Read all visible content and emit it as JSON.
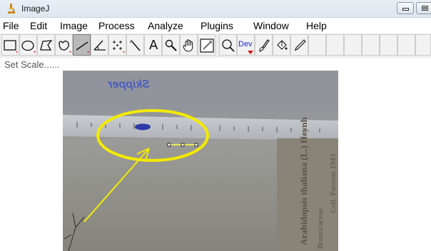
{
  "window": {
    "title": "ImageJ",
    "title_icon": "microscope-icon",
    "controls": [
      "minimize-icon",
      "maximize-icon"
    ]
  },
  "menu": [
    {
      "label": "File"
    },
    {
      "label": "Edit"
    },
    {
      "label": "Image"
    },
    {
      "label": "Process"
    },
    {
      "label": "Analyze"
    },
    {
      "label": "Plugins"
    },
    {
      "label": "Window"
    },
    {
      "label": "Help"
    }
  ],
  "toolbar": {
    "tools": [
      {
        "name": "rectangle-tool",
        "icon": "rectangle-icon"
      },
      {
        "name": "oval-tool",
        "icon": "oval-icon"
      },
      {
        "name": "polygon-tool",
        "icon": "polygon-icon"
      },
      {
        "name": "freehand-tool",
        "icon": "freehand-icon"
      },
      {
        "name": "straight-line-tool",
        "icon": "line-icon",
        "selected": true
      },
      {
        "name": "angle-tool",
        "icon": "angle-icon"
      },
      {
        "name": "point-tool",
        "icon": "multipoint-icon"
      },
      {
        "name": "wand-tool",
        "icon": "wand-icon"
      },
      {
        "name": "text-tool",
        "icon": "text-icon",
        "label": "A"
      },
      {
        "name": "magnifying-glass-tool",
        "icon": "magnifier-icon"
      },
      {
        "name": "scrolling-tool",
        "icon": "hand-icon"
      },
      {
        "name": "color-picker-tool",
        "icon": "color-picker-icon"
      },
      {
        "name": "zoom-tool",
        "icon": "zoom-icon"
      },
      {
        "name": "developer-menu-tool",
        "icon": "dev-icon",
        "label": "Dev"
      },
      {
        "name": "brush-tool",
        "icon": "brush-icon"
      },
      {
        "name": "flood-fill-tool",
        "icon": "fill-icon"
      },
      {
        "name": "pencil-tool",
        "icon": "pen-icon"
      }
    ]
  },
  "status": {
    "text": "Set Scale......"
  },
  "image": {
    "ruler_print": "Skipper",
    "specimen_text_1": "Arabidopsis thaliana (L.) Heynh",
    "specimen_text_2": "Brassicaceae",
    "specimen_text_3": "Coll. Parsons 1943",
    "annotation_color": "#f3ea00",
    "selection_color": "#ffff44"
  },
  "colors": {
    "selected_tool": "#b9b9b9",
    "dev_text": "#1a2bd6"
  }
}
